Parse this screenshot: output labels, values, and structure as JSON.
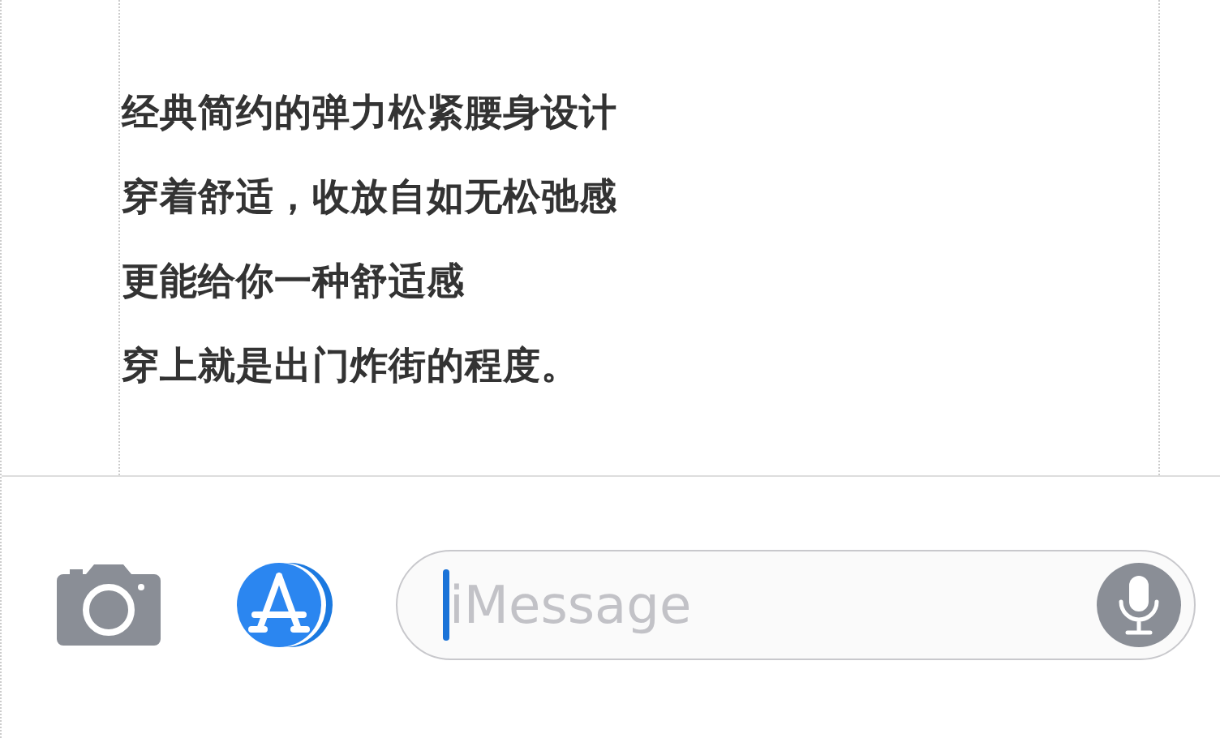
{
  "paragraphs": [
    "经典简约的弹力松紧腰身设计",
    "穿着舒适，收放自如无松弛感",
    "更能给你一种舒适感",
    "穿上就是出门炸街的程度。"
  ],
  "composer": {
    "placeholder": "iMessage"
  }
}
